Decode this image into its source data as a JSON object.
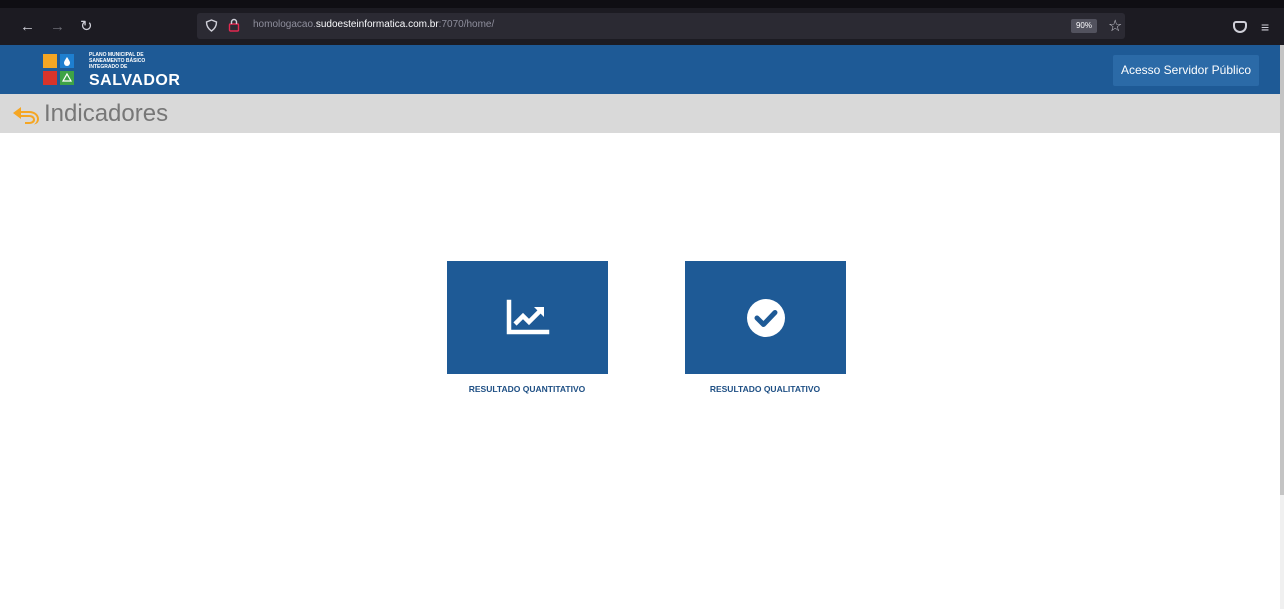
{
  "browser": {
    "url_prefix": "homologacao.",
    "url_domain": "sudoesteinformatica.com.br",
    "url_suffix": ":7070/home/",
    "zoom": "90%"
  },
  "header": {
    "logo_line1": "PLANO MUNICIPAL DE",
    "logo_line2": "SANEAMENTO BÁSICO",
    "logo_line3": "INTEGRADO DE",
    "logo_city": "SALVADOR",
    "access_button": "Acesso Servidor Público"
  },
  "page": {
    "title": "Indicadores"
  },
  "tiles": [
    {
      "label": "RESULTADO QUANTITATIVO",
      "icon": "chart-line-up-icon"
    },
    {
      "label": "RESULTADO QUALITATIVO",
      "icon": "check-circle-icon"
    }
  ],
  "colors": {
    "brand_blue": "#1e5a96",
    "accent_orange": "#f5a623",
    "label_blue": "#1e4f84"
  }
}
